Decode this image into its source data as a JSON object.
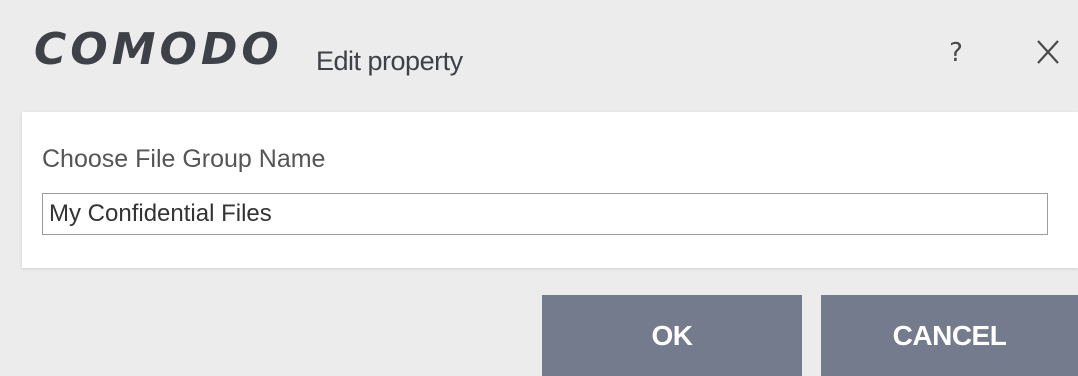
{
  "header": {
    "logo_text": "COMODO",
    "title": "Edit property",
    "help_label": "?"
  },
  "form": {
    "label": "Choose File Group Name",
    "value": "My Confidential Files"
  },
  "buttons": {
    "ok_label": "OK",
    "cancel_label": "CANCEL"
  },
  "colors": {
    "button_bg": "#737b8c",
    "button_text": "#ffffff",
    "dialog_bg": "#ececec",
    "panel_bg": "#ffffff",
    "logo": "#3e4147"
  },
  "icons": {
    "close": "close-icon"
  }
}
